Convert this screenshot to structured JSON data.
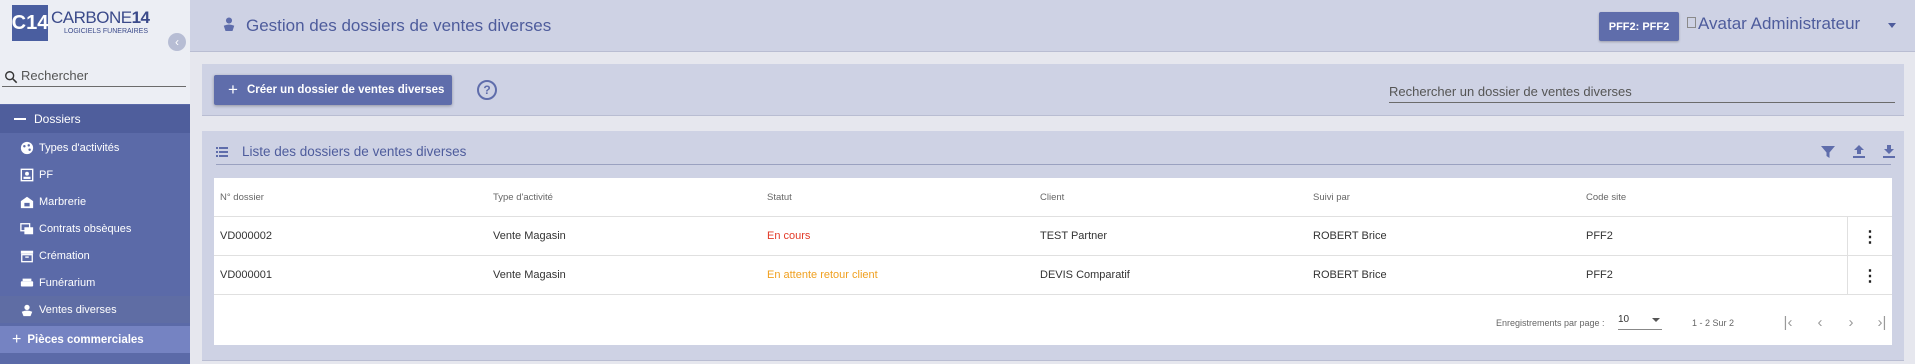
{
  "brand": {
    "logo_mark": "C14",
    "name_regular": "CARBONE",
    "name_bold": "14",
    "tagline": "LOGICIELS FUNERAIRES"
  },
  "sidebar": {
    "search_placeholder": "Rechercher",
    "group_label": "Dossiers",
    "items": [
      {
        "label": "Types d'activités",
        "icon": "palette-icon"
      },
      {
        "label": "PF",
        "icon": "contact-card-icon"
      },
      {
        "label": "Marbrerie",
        "icon": "marble-building-icon"
      },
      {
        "label": "Contrats obsèques",
        "icon": "contract-icon"
      },
      {
        "label": "Crémation",
        "icon": "urn-box-icon"
      },
      {
        "label": "Funérarium",
        "icon": "funeral-home-icon"
      },
      {
        "label": "Ventes diverses",
        "icon": "sales-icon"
      }
    ],
    "section_label": "Pièces commerciales"
  },
  "header": {
    "title": "Gestion des dossiers de ventes diverses",
    "site_button": "PFF2: PFF2",
    "avatar_text": "Avatar Administrateur"
  },
  "actions": {
    "create_label": "Créer un dossier de ventes diverses",
    "help_label": "?",
    "search_placeholder": "Rechercher un dossier de ventes diverses"
  },
  "panel": {
    "title": "Liste des dossiers de ventes diverses",
    "columns": [
      "N° dossier",
      "Type d'activité",
      "Statut",
      "Client",
      "Suivi par",
      "Code site"
    ],
    "rows": [
      {
        "dossier": "VD000002",
        "type": "Vente Magasin",
        "statut": "En cours",
        "client": "TEST Partner",
        "suivi": "ROBERT Brice",
        "site": "PFF2"
      },
      {
        "dossier": "VD000001",
        "type": "Vente Magasin",
        "statut": "En attente retour client",
        "client": "DEVIS Comparatif",
        "suivi": "ROBERT Brice",
        "site": "PFF2"
      }
    ],
    "status_colors": {
      "En cours": "#e23a28",
      "En attente retour client": "#f0a020"
    },
    "pager": {
      "per_page_label": "Enregistrements par page :",
      "per_page_value": "10",
      "range": "1 - 2 Sur 2"
    }
  },
  "colors": {
    "sidebar": "#5b6aa8",
    "accent": "#5f6dab",
    "header": "#ced2e4"
  }
}
